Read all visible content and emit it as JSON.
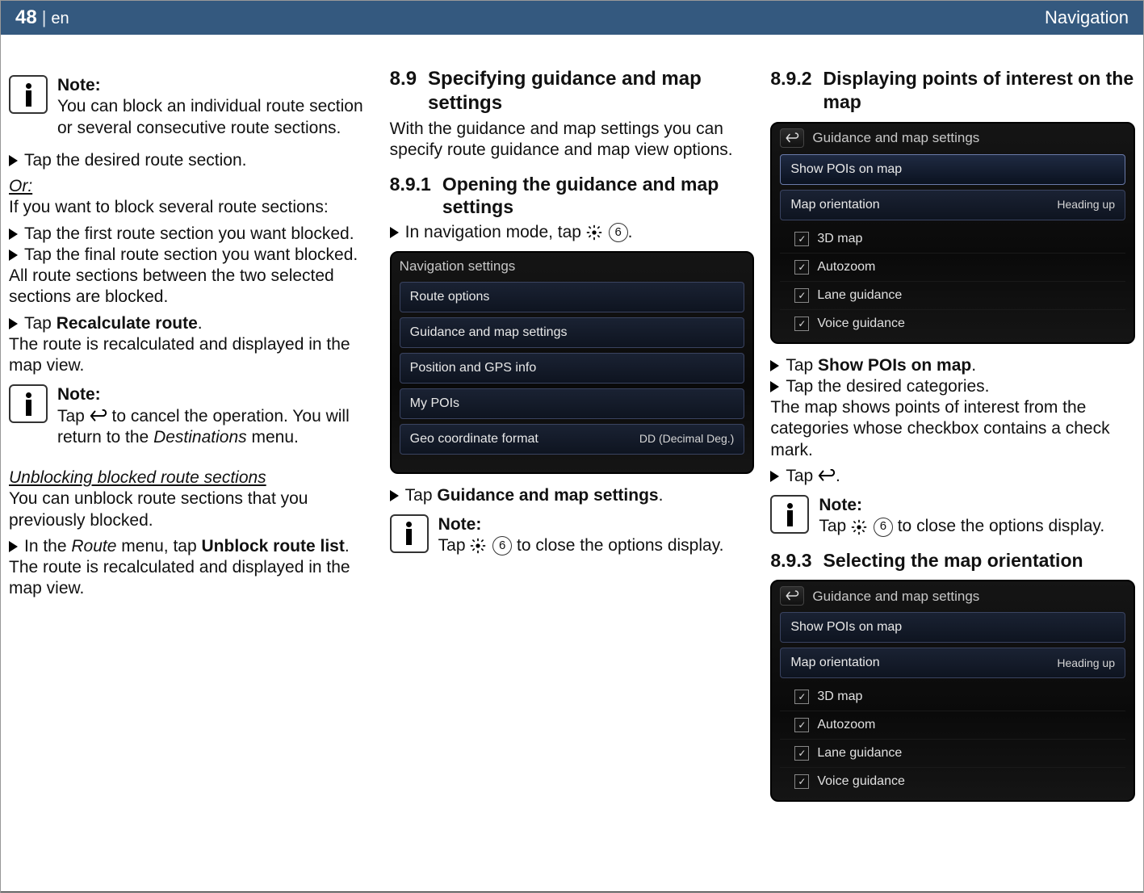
{
  "header": {
    "page_number": "48",
    "divider": "|",
    "lang": "en",
    "section_name": "Navigation"
  },
  "col1": {
    "note1_title": "Note:",
    "note1_body": "You can block an individual route section or several consecutive route sections.",
    "step_tap_section": "Tap the desired route section.",
    "or_label": "Or:",
    "block_several_intro": "If you want to block several route sections:",
    "step_first": "Tap the first route section you want blocked.",
    "step_final": "Tap the final route section you want blocked.",
    "between_text": "All route sections between the two selected sections are blocked.",
    "step_recalc_pre": "Tap ",
    "step_recalc_bold": "Recalculate route",
    "step_recalc_post": ".",
    "recalc_result": "The route is recalculated and displayed in the map view.",
    "note2_title": "Note:",
    "note2_pre": "Tap ",
    "note2_mid": " to cancel the operation. You will return to the ",
    "note2_italic": "Destinations",
    "note2_post": " menu.",
    "unblock_heading": "Unblocking blocked route sections",
    "unblock_intro": "You can unblock route sections that you previously blocked.",
    "unblock_step_pre": "In the ",
    "unblock_step_italic": "Route",
    "unblock_step_mid": " menu, tap ",
    "unblock_step_bold": "Unblock route list",
    "unblock_step_post": ".",
    "unblock_result": "The route is recalculated and displayed in the map view."
  },
  "col2": {
    "h89_num": "8.9",
    "h89_title": "Specifying guidance and map settings",
    "h89_intro": "With the guidance and map settings you can specify route guidance and map view options.",
    "h891_num": "8.9.1",
    "h891_title": "Opening the guidance and map settings",
    "step_navmode_pre": "In navigation mode, tap ",
    "circ_6a": "6",
    "step_navmode_post": ".",
    "device1_title": "Navigation settings",
    "device1_rows": [
      "Route options",
      "Guidance and map settings",
      "Position and GPS info",
      "My POIs"
    ],
    "device1_row_geo_left": "Geo coordinate format",
    "device1_row_geo_right": "DD (Decimal Deg.)",
    "step_tap_gms_pre": "Tap ",
    "step_tap_gms_bold": "Guidance and map settings",
    "step_tap_gms_post": ".",
    "note3_title": "Note:",
    "note3_pre": "Tap ",
    "circ_6b": "6",
    "note3_post": " to close the options display."
  },
  "col3": {
    "h892_num": "8.9.2",
    "h892_title": "Displaying points of interest on the map",
    "device2_title": "Guidance and map settings",
    "device2_hl_row": "Show POIs on map",
    "device2_row_map_orient_left": "Map orientation",
    "device2_row_map_orient_right": "Heading up",
    "device2_checks": [
      "3D map",
      "Autozoom",
      "Lane guidance",
      "Voice guidance"
    ],
    "step_show_pois_pre": "Tap ",
    "step_show_pois_bold": "Show POIs on map",
    "step_show_pois_post": ".",
    "step_categories": "Tap the desired categories.",
    "poi_result": "The map shows points of interest from the categories whose checkbox contains a check mark.",
    "step_tap_back_pre": "Tap ",
    "step_tap_back_post": ".",
    "note4_title": "Note:",
    "note4_pre": "Tap ",
    "circ_6c": "6",
    "note4_post": " to close the options display.",
    "h893_num": "8.9.3",
    "h893_title": "Selecting the map orientation",
    "device3_title": "Guidance and map settings",
    "device3_row_show": "Show POIs on map",
    "device3_row_map_orient_left": "Map orientation",
    "device3_row_map_orient_right": "Heading up",
    "device3_checks": [
      "3D map",
      "Autozoom",
      "Lane guidance",
      "Voice guidance"
    ]
  }
}
